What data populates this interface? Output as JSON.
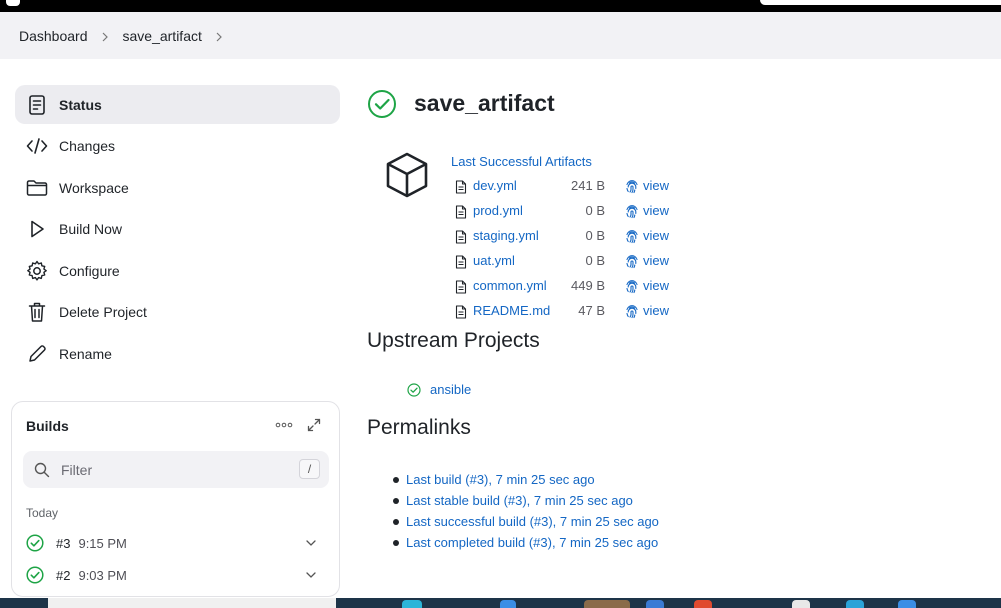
{
  "breadcrumb": {
    "items": [
      "Dashboard",
      "save_artifact"
    ]
  },
  "sidebar": {
    "items": [
      {
        "label": "Status",
        "icon": "status-icon",
        "active": true
      },
      {
        "label": "Changes",
        "icon": "code-icon"
      },
      {
        "label": "Workspace",
        "icon": "folder-icon"
      },
      {
        "label": "Build Now",
        "icon": "play-icon"
      },
      {
        "label": "Configure",
        "icon": "gear-icon"
      },
      {
        "label": "Delete Project",
        "icon": "trash-icon"
      },
      {
        "label": "Rename",
        "icon": "pencil-icon"
      }
    ]
  },
  "builds": {
    "title": "Builds",
    "filter_placeholder": "Filter",
    "filter_shortcut": "/",
    "group_label": "Today",
    "rows": [
      {
        "number": "#3",
        "time": "9:15 PM"
      },
      {
        "number": "#2",
        "time": "9:03 PM"
      }
    ]
  },
  "main": {
    "title": "save_artifact",
    "artifacts_heading": "Last Successful Artifacts",
    "view_label": "view",
    "artifacts": [
      {
        "name": "dev.yml",
        "size": "241 B"
      },
      {
        "name": "prod.yml",
        "size": "0 B"
      },
      {
        "name": "staging.yml",
        "size": "0 B"
      },
      {
        "name": "uat.yml",
        "size": "0 B"
      },
      {
        "name": "common.yml",
        "size": "449 B"
      },
      {
        "name": "README.md",
        "size": "47 B"
      }
    ],
    "upstream_heading": "Upstream Projects",
    "upstream": [
      "ansible"
    ],
    "permalinks_heading": "Permalinks",
    "permalinks": [
      "Last build (#3), 7 min 25 sec ago",
      "Last stable build (#3), 7 min 25 sec ago",
      "Last successful build (#3), 7 min 25 sec ago",
      "Last completed build (#3), 7 min 25 sec ago"
    ]
  },
  "colors": {
    "link": "#1467c4",
    "success": "#1ea446",
    "nav_active_bg": "#ececf0",
    "breadcrumb_bg": "#f2f2f5"
  }
}
